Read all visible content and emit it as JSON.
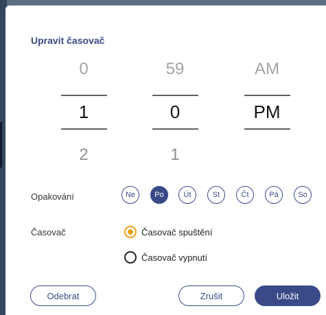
{
  "dialog": {
    "title": "Upravit časovač"
  },
  "time_picker": {
    "hour": {
      "prev": "0",
      "current": "1",
      "next": "2"
    },
    "minute": {
      "prev": "59",
      "current": "0",
      "next": "1"
    },
    "ampm": {
      "prev": "AM",
      "current": "PM",
      "next": ""
    }
  },
  "repeat": {
    "label": "Opakování",
    "days": [
      {
        "label": "Ne",
        "selected": false
      },
      {
        "label": "Po",
        "selected": true
      },
      {
        "label": "Út",
        "selected": false
      },
      {
        "label": "St",
        "selected": false
      },
      {
        "label": "Čt",
        "selected": false
      },
      {
        "label": "Pá",
        "selected": false
      },
      {
        "label": "So",
        "selected": false
      }
    ]
  },
  "timer": {
    "label": "Časovač",
    "options": [
      {
        "label": "Časovač spuštění",
        "selected": true
      },
      {
        "label": "Časovač vypnutí",
        "selected": false
      }
    ]
  },
  "buttons": {
    "remove": "Odebrat",
    "cancel": "Zrušit",
    "save": "Uložit"
  },
  "colors": {
    "accent": "#3a4a88",
    "radio_selected": "#f0a01a",
    "backdrop": "#5d6d84"
  }
}
